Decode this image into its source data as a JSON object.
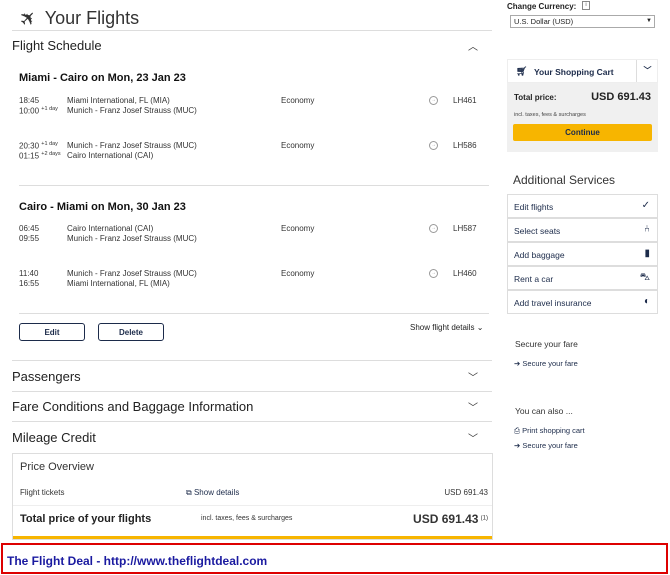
{
  "header": {
    "title": "Your Flights"
  },
  "flight_schedule": {
    "title": "Flight Schedule",
    "routes": [
      {
        "title": "Miami - Cairo on Mon, 23 Jan 23",
        "segments": [
          {
            "dep_time": "18:45",
            "dep_day": "",
            "arr_time": "10:00",
            "arr_day": "+1 day",
            "dep_airport": "Miami International, FL (MIA)",
            "arr_airport": "Munich - Franz Josef Strauss (MUC)",
            "class": "Economy",
            "flight": "LH461"
          },
          {
            "dep_time": "20:30",
            "dep_day": "+1 day",
            "arr_time": "01:15",
            "arr_day": "+2 days",
            "dep_airport": "Munich - Franz Josef Strauss (MUC)",
            "arr_airport": "Cairo International (CAI)",
            "class": "Economy",
            "flight": "LH586"
          }
        ]
      },
      {
        "title": "Cairo - Miami on Mon, 30 Jan 23",
        "segments": [
          {
            "dep_time": "06:45",
            "dep_day": "",
            "arr_time": "09:55",
            "arr_day": "",
            "dep_airport": "Cairo International (CAI)",
            "arr_airport": "Munich - Franz Josef Strauss (MUC)",
            "class": "Economy",
            "flight": "LH587"
          },
          {
            "dep_time": "11:40",
            "dep_day": "",
            "arr_time": "16:55",
            "arr_day": "",
            "dep_airport": "Munich - Franz Josef Strauss (MUC)",
            "arr_airport": "Miami International, FL (MIA)",
            "class": "Economy",
            "flight": "LH460"
          }
        ]
      }
    ],
    "edit_label": "Edit",
    "delete_label": "Delete",
    "show_details_label": "Show flight details"
  },
  "sections": {
    "passengers": "Passengers",
    "fare_conditions": "Fare Conditions and Baggage Information",
    "mileage": "Mileage Credit"
  },
  "price_overview": {
    "title": "Price Overview",
    "tickets_label": "Flight tickets",
    "show_details": "Show details",
    "tickets_value": "USD 691.43",
    "total_label": "Total price of your flights",
    "total_note": "incl. taxes, fees & surcharges",
    "total_value": "USD 691.43",
    "total_footnote": "(1)"
  },
  "currency": {
    "label": "Change Currency:",
    "info": "i",
    "selected": "U.S. Dollar (USD)"
  },
  "cart": {
    "title": "Your Shopping Cart",
    "total_label": "Total price:",
    "total_value": "USD 691.43",
    "note": "incl. taxes, fees & surcharges",
    "continue_label": "Continue"
  },
  "additional_services": {
    "title": "Additional Services",
    "items": [
      {
        "label": "Edit flights",
        "icon": "check-icon"
      },
      {
        "label": "Select seats",
        "icon": "seat-icon"
      },
      {
        "label": "Add baggage",
        "icon": "baggage-icon"
      },
      {
        "label": "Rent a car",
        "icon": "car-icon"
      },
      {
        "label": "Add travel insurance",
        "icon": "shield-icon"
      }
    ]
  },
  "secure_fare": {
    "title": "Secure your fare",
    "link": "Secure your fare"
  },
  "also": {
    "title": "You can also ...",
    "print_link": "Print shopping cart",
    "secure_link": "Secure your fare"
  },
  "footer": {
    "text": "The Flight Deal - http://www.theflightdeal.com"
  },
  "colors": {
    "accent": "#f7b500",
    "navy": "#1c2b4a",
    "footer_border": "#dd0000",
    "footer_text": "#1a1aa0"
  }
}
